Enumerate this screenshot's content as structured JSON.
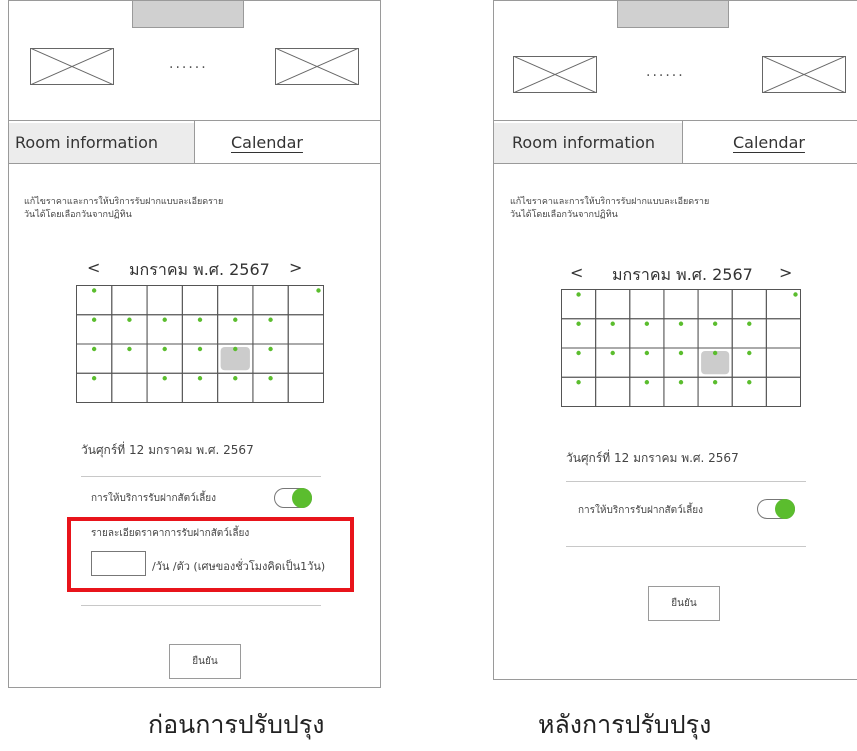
{
  "header": {
    "dots": "......"
  },
  "tabs": {
    "room_info": "Room information",
    "calendar": "Calendar"
  },
  "instruction": "แก้ไขราคาและการให้บริการรับฝากแบบละเอียดราย\nวันได้โดยเลือกวันจากปฏิทิน",
  "calendar": {
    "prev": "<",
    "month_label": "มกราคม พ.ศ. 2567",
    "next": ">",
    "rows": 4,
    "cols": 7,
    "selected_cell": [
      2,
      4
    ],
    "dot_color": "#5bbd2e",
    "selected_color": "#cccccc",
    "dot_cells": [
      [
        0,
        0
      ],
      [
        0,
        6
      ],
      [
        1,
        0
      ],
      [
        1,
        1
      ],
      [
        1,
        2
      ],
      [
        1,
        3
      ],
      [
        1,
        4
      ],
      [
        1,
        5
      ],
      [
        2,
        0
      ],
      [
        2,
        1
      ],
      [
        2,
        2
      ],
      [
        2,
        3
      ],
      [
        2,
        4
      ],
      [
        2,
        5
      ],
      [
        3,
        0
      ],
      [
        3,
        2
      ],
      [
        3,
        3
      ],
      [
        3,
        4
      ],
      [
        3,
        5
      ]
    ]
  },
  "selected_date": "วันศุกร์ที่ 12 มกราคม พ.ศ. 2567",
  "service_label": "การให้บริการรับฝากสัตว์เลี้ยง",
  "toggle_on": true,
  "toggle_color": "#5bbd2e",
  "price_detail_label": "รายละเอียดราคาการรับฝากสัตว์เลี้ยง",
  "price_value": "",
  "price_unit": "/วัน /ตัว (เศษของชั่วโมงคิดเป็น1วัน)",
  "highlight_color": "#e8141b",
  "confirm_label": "ยืนยัน",
  "captions": {
    "before": "ก่อนการปรับปรุง",
    "after": "หลังการปรับปรุง"
  }
}
